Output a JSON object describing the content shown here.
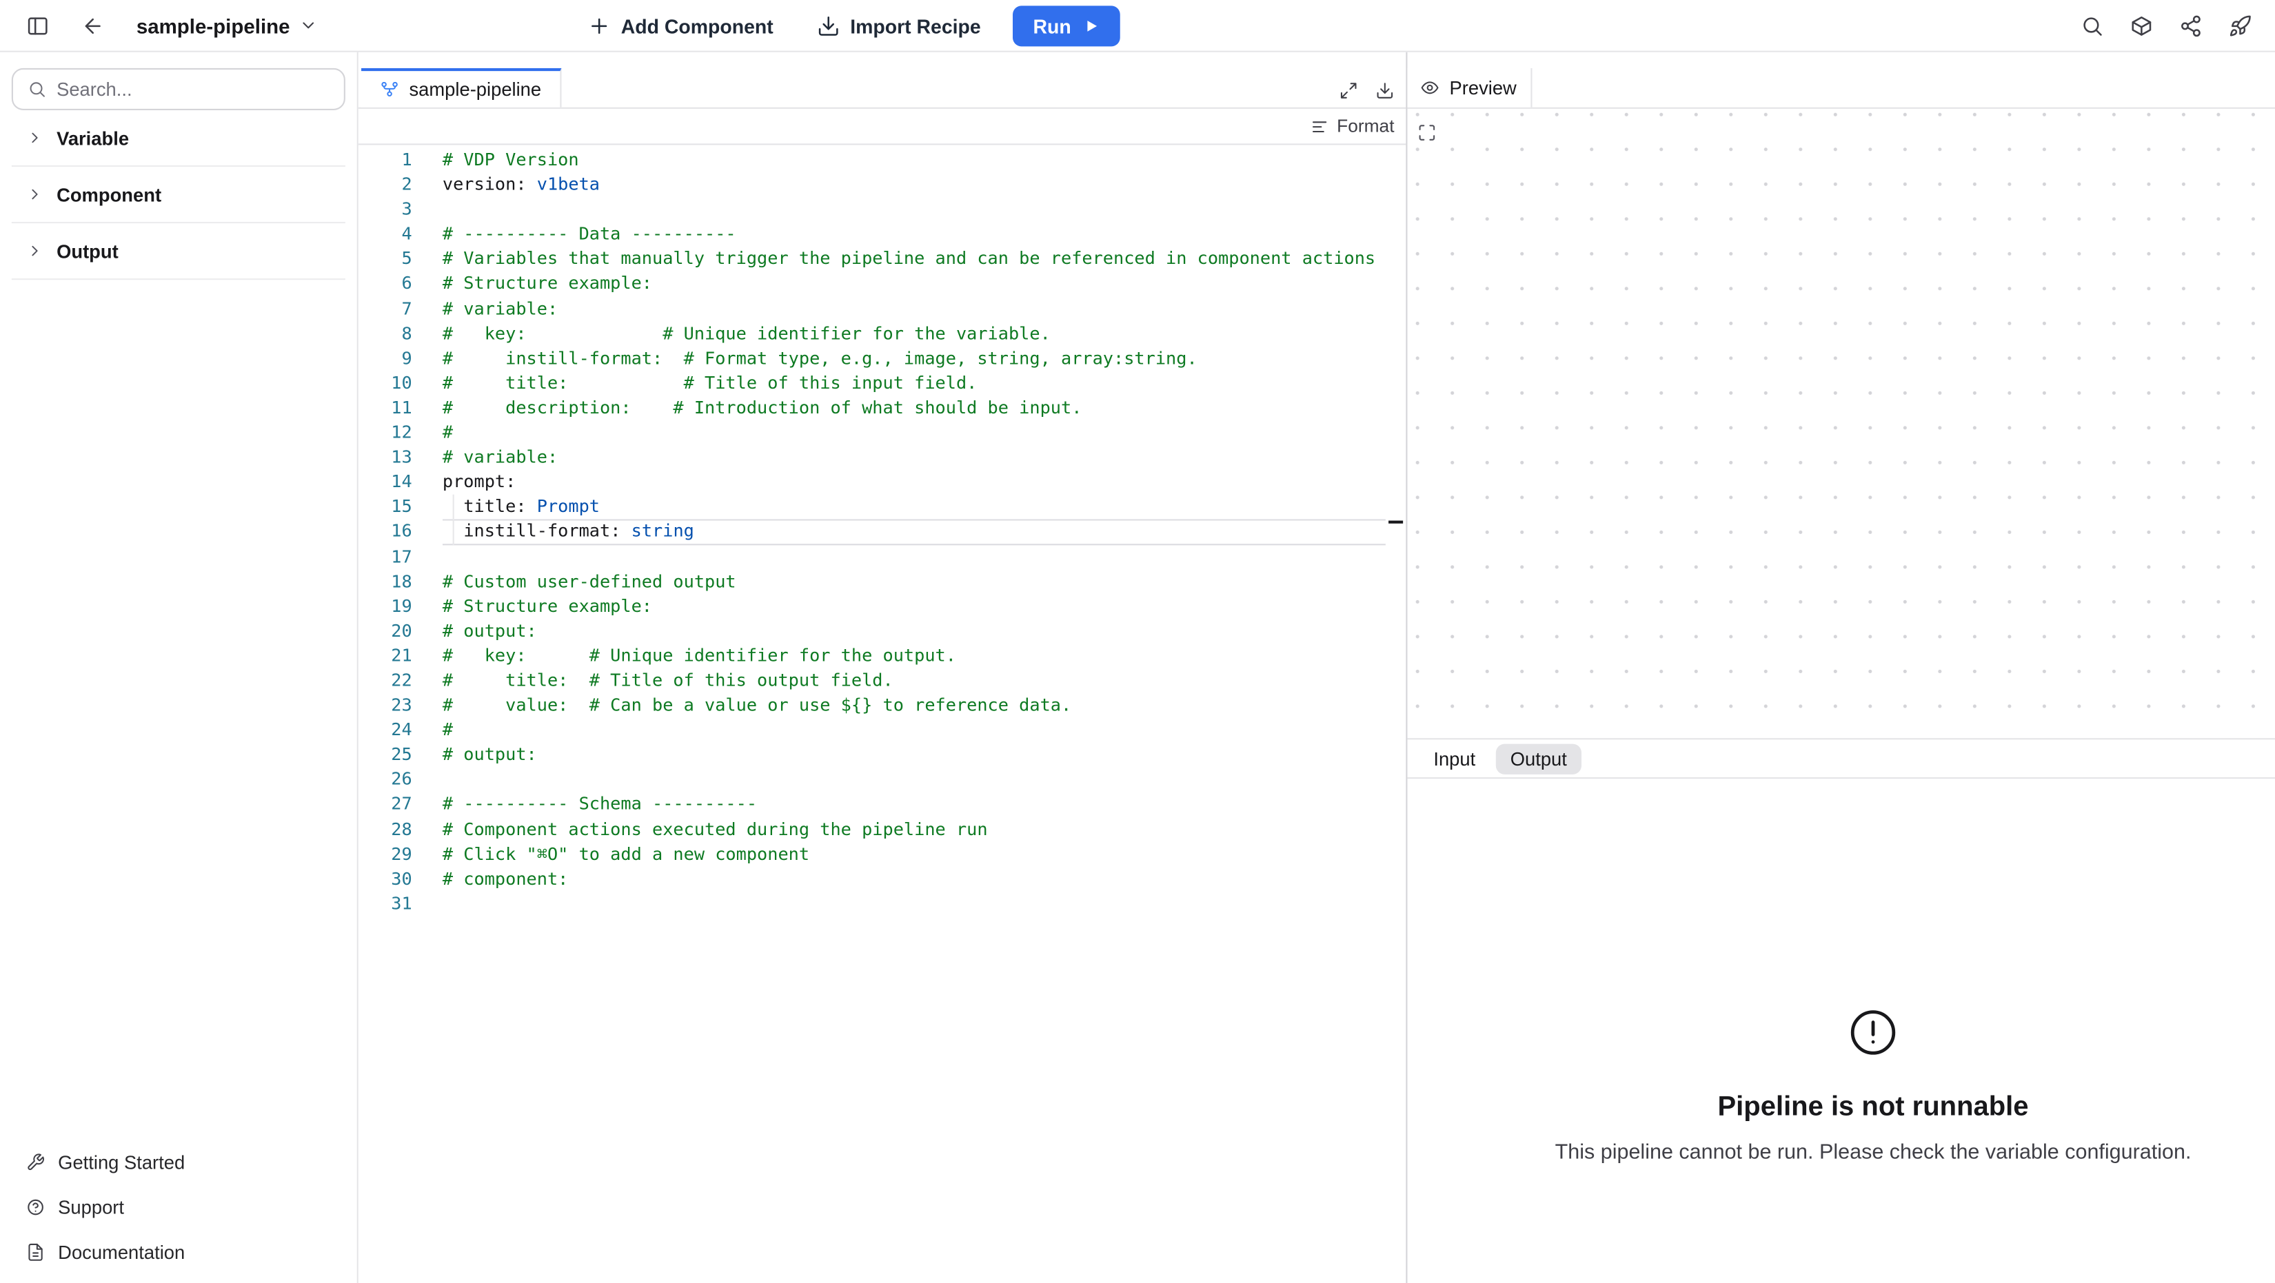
{
  "header": {
    "title": "sample-pipeline",
    "buttons": {
      "add_component": "Add Component",
      "import_recipe": "Import Recipe",
      "run": "Run"
    }
  },
  "sidebar": {
    "search_placeholder": "Search...",
    "sections": [
      {
        "label": "Variable"
      },
      {
        "label": "Component"
      },
      {
        "label": "Output"
      }
    ],
    "footer": [
      {
        "label": "Getting Started",
        "icon": "wrench-icon"
      },
      {
        "label": "Support",
        "icon": "help-icon"
      },
      {
        "label": "Documentation",
        "icon": "documentation-icon"
      }
    ]
  },
  "editor": {
    "tab_label": "sample-pipeline",
    "format_label": "Format",
    "active_line": 16,
    "lines": [
      {
        "tokens": [
          {
            "t": "comment",
            "s": "# VDP Version"
          }
        ]
      },
      {
        "tokens": [
          {
            "t": "key",
            "s": "version"
          },
          {
            "t": "plain",
            "s": ": "
          },
          {
            "t": "value",
            "s": "v1beta"
          }
        ]
      },
      {
        "tokens": []
      },
      {
        "tokens": [
          {
            "t": "comment",
            "s": "# ---------- Data ----------"
          }
        ]
      },
      {
        "tokens": [
          {
            "t": "comment",
            "s": "# Variables that manually trigger the pipeline and can be referenced in component actions"
          }
        ]
      },
      {
        "tokens": [
          {
            "t": "comment",
            "s": "# Structure example:"
          }
        ]
      },
      {
        "tokens": [
          {
            "t": "comment",
            "s": "# variable:"
          }
        ]
      },
      {
        "tokens": [
          {
            "t": "comment",
            "s": "#   key:             # Unique identifier for the variable."
          }
        ]
      },
      {
        "tokens": [
          {
            "t": "comment",
            "s": "#     instill-format:  # Format type, e.g., image, string, array:string."
          }
        ]
      },
      {
        "tokens": [
          {
            "t": "comment",
            "s": "#     title:           # Title of this input field."
          }
        ]
      },
      {
        "tokens": [
          {
            "t": "comment",
            "s": "#     description:    # Introduction of what should be input."
          }
        ]
      },
      {
        "tokens": [
          {
            "t": "comment",
            "s": "#"
          }
        ]
      },
      {
        "tokens": [
          {
            "t": "comment",
            "s": "# variable:"
          }
        ]
      },
      {
        "tokens": [
          {
            "t": "key",
            "s": "prompt"
          },
          {
            "t": "plain",
            "s": ":"
          }
        ]
      },
      {
        "indent": true,
        "tokens": [
          {
            "t": "plain",
            "s": "  "
          },
          {
            "t": "key",
            "s": "title"
          },
          {
            "t": "plain",
            "s": ": "
          },
          {
            "t": "value",
            "s": "Prompt"
          }
        ]
      },
      {
        "indent": true,
        "tokens": [
          {
            "t": "plain",
            "s": "  "
          },
          {
            "t": "key",
            "s": "instill-format"
          },
          {
            "t": "plain",
            "s": ": "
          },
          {
            "t": "value",
            "s": "string"
          }
        ]
      },
      {
        "tokens": []
      },
      {
        "tokens": [
          {
            "t": "comment",
            "s": "# Custom user-defined output"
          }
        ]
      },
      {
        "tokens": [
          {
            "t": "comment",
            "s": "# Structure example:"
          }
        ]
      },
      {
        "tokens": [
          {
            "t": "comment",
            "s": "# output:"
          }
        ]
      },
      {
        "tokens": [
          {
            "t": "comment",
            "s": "#   key:      # Unique identifier for the output."
          }
        ]
      },
      {
        "tokens": [
          {
            "t": "comment",
            "s": "#     title:  # Title of this output field."
          }
        ]
      },
      {
        "tokens": [
          {
            "t": "comment",
            "s": "#     value:  # Can be a value or use ${} to reference data."
          }
        ]
      },
      {
        "tokens": [
          {
            "t": "comment",
            "s": "#"
          }
        ]
      },
      {
        "tokens": [
          {
            "t": "comment",
            "s": "# output:"
          }
        ]
      },
      {
        "tokens": []
      },
      {
        "tokens": [
          {
            "t": "comment",
            "s": "# ---------- Schema ----------"
          }
        ]
      },
      {
        "tokens": [
          {
            "t": "comment",
            "s": "# Component actions executed during the pipeline run"
          }
        ]
      },
      {
        "tokens": [
          {
            "t": "comment",
            "s": "# Click \"⌘O\" to add a new component"
          }
        ]
      },
      {
        "tokens": [
          {
            "t": "comment",
            "s": "# component:"
          }
        ]
      },
      {
        "tokens": []
      }
    ]
  },
  "preview": {
    "tab_label": "Preview",
    "input_tab": "Input",
    "output_tab": "Output",
    "empty_state": {
      "title": "Pipeline is not runnable",
      "message": "This pipeline cannot be run. Please check the variable configuration."
    }
  },
  "colors": {
    "accent": "#316fed",
    "comment": "#0e7a22",
    "key": "#18181b",
    "value": "#0550ae",
    "line_number": "#237893"
  }
}
